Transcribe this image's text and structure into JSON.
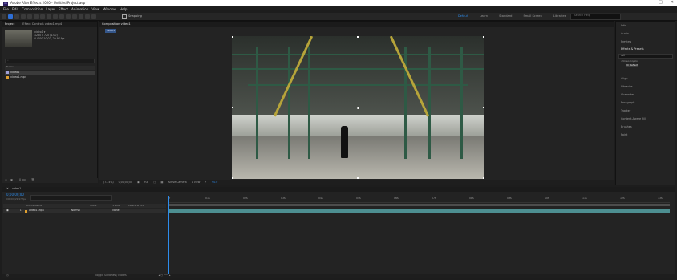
{
  "window": {
    "title": "Adobe After Effects 2020 - Untitled Project.aep *",
    "controls": [
      "–",
      "□",
      "✕"
    ]
  },
  "menu": [
    "File",
    "Edit",
    "Composition",
    "Layer",
    "Effect",
    "Animation",
    "View",
    "Window",
    "Help"
  ],
  "toolbar": {
    "snapping": "Snapping"
  },
  "workspaces": {
    "items": [
      "Default",
      "Learn",
      "Standard",
      "Small Screen",
      "Libraries"
    ],
    "active": "Default"
  },
  "search_help": {
    "placeholder": "Search Help"
  },
  "project": {
    "tabs": [
      "Project",
      "Effect Controls video1.mp4"
    ],
    "thumb_info": [
      "video1 ▾",
      "1280 x 720 (1.00)",
      "Δ 0;00;10;02, 29.97 fps"
    ],
    "columns": {
      "name": "Name"
    },
    "items": [
      {
        "name": "video1",
        "color": "#a0a0d8",
        "selected": true
      },
      {
        "name": "video1.mp4",
        "color": "#e0a030",
        "selected": false
      }
    ],
    "footer_bpc": "8 bpc"
  },
  "viewer": {
    "tab": "Composition video1",
    "subtab": "video1",
    "footer": {
      "zoom": "(73.4%)",
      "time": "0;00;00;00",
      "quality": "Full",
      "camera": "Active Camera",
      "views": "1 View",
      "offset": "+0.0"
    }
  },
  "right_panel": {
    "items": [
      "Info",
      "Audio",
      "Preview",
      "Effects & Presets",
      "Align",
      "Libraries",
      "Character",
      "Paragraph",
      "Tracker",
      "Content-Aware Fill",
      "Brushes",
      "Paint"
    ],
    "search_value": "roll",
    "tree": [
      "› Video Copilot",
      "VC Reflect"
    ]
  },
  "timeline": {
    "tab": "video1",
    "timecode": "0;00;00;00",
    "fps_note": "00000 (29.97 fps)",
    "columns": [
      "Source Name",
      "Mode",
      "T",
      "TrkMat",
      "Parent & Link"
    ],
    "layer": {
      "index": "1",
      "name": "video1.mp4",
      "mode": "Normal",
      "parent": "None"
    },
    "ruler": [
      "0f",
      "01s",
      "02s",
      "03s",
      "04s",
      "05s",
      "06s",
      "07s",
      "08s",
      "09s",
      "10s",
      "11s",
      "12s",
      "13s"
    ],
    "footer": "Toggle Switches / Modes"
  }
}
